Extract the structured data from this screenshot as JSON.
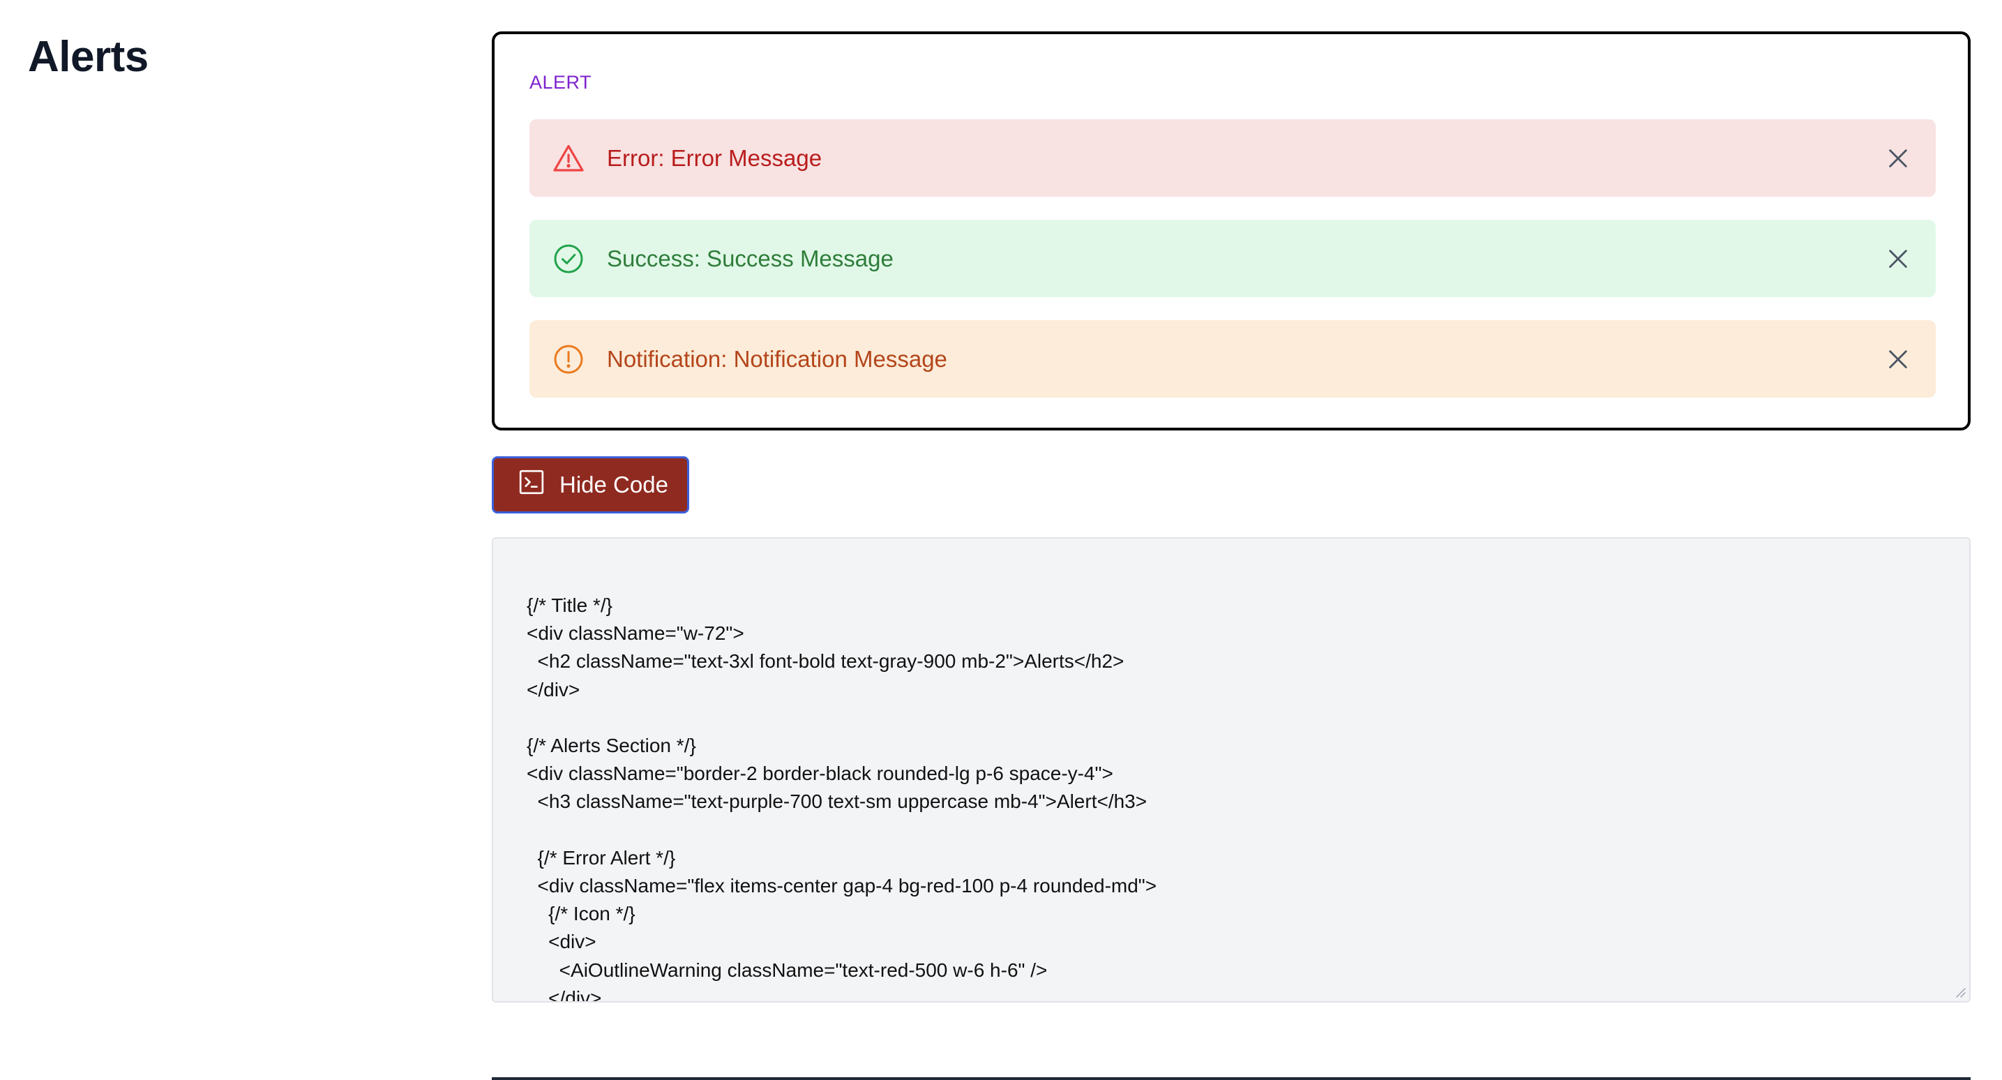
{
  "page": {
    "title": "Alerts"
  },
  "alerts_section": {
    "heading": "ALERT",
    "alerts": [
      {
        "type": "error",
        "icon": "warning-triangle-icon",
        "text": "Error: Error Message",
        "color": "#b91c1c",
        "background": "#f8e2e2"
      },
      {
        "type": "success",
        "icon": "check-circle-icon",
        "text": "Success: Success Message",
        "color": "#2e7d3a",
        "background": "#e1f8e8"
      },
      {
        "type": "notification",
        "icon": "exclamation-circle-icon",
        "text": "Notification: Notification Message",
        "color": "#b4451a",
        "background": "#fcecd9"
      }
    ],
    "close_icon": "close-icon"
  },
  "toolbar": {
    "toggle_code_label": "Hide Code",
    "toggle_code_icon": "terminal-icon",
    "button_color": "#8f2a20"
  },
  "code": {
    "content": "{/* Title */}\n<div className=\"w-72\">\n  <h2 className=\"text-3xl font-bold text-gray-900 mb-2\">Alerts</h2>\n</div>\n\n{/* Alerts Section */}\n<div className=\"border-2 border-black rounded-lg p-6 space-y-4\">\n  <h3 className=\"text-purple-700 text-sm uppercase mb-4\">Alert</h3>\n\n  {/* Error Alert */}\n  <div className=\"flex items-center gap-4 bg-red-100 p-4 rounded-md\">\n    {/* Icon */}\n    <div>\n      <AiOutlineWarning className=\"text-red-500 w-6 h-6\" />\n    </div>"
  }
}
